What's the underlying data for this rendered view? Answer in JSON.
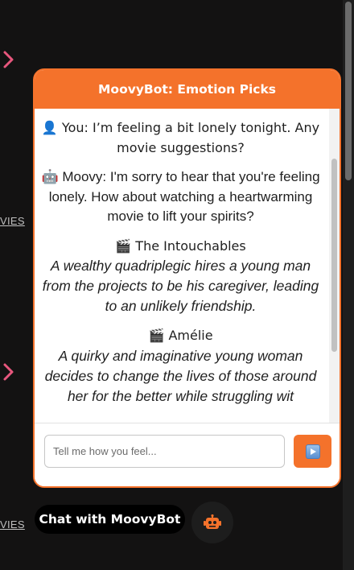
{
  "background": {
    "links": [
      "VIES",
      "VIES"
    ]
  },
  "chat": {
    "title": "MoovyBot: Emotion Picks",
    "user_message": "👤 You: I’m feeling a bit lonely tonight. Any movie suggestions?",
    "bot_message": "🤖 Moovy: I'm sorry to hear that you're feeling lonely. How about watching a heartwarming movie to lift your spirits?",
    "movies": [
      {
        "title": "🎬 The Intouchables",
        "description": "A wealthy quadriplegic hires a young man from the projects to be his caregiver, leading to an unlikely friendship."
      },
      {
        "title": "🎬 Amélie",
        "description": "A quirky and imaginative young woman decides to change the lives of those around her for the better while struggling wit"
      }
    ],
    "input": {
      "value": "",
      "placeholder": "Tell me how you feel..."
    },
    "send_icon": "play-button-icon"
  },
  "launcher": {
    "label": "Chat with MoovyBot",
    "icon": "robot-icon"
  },
  "colors": {
    "accent": "#f4722b",
    "page_background": "#131212",
    "chevron": "#e8577d"
  }
}
